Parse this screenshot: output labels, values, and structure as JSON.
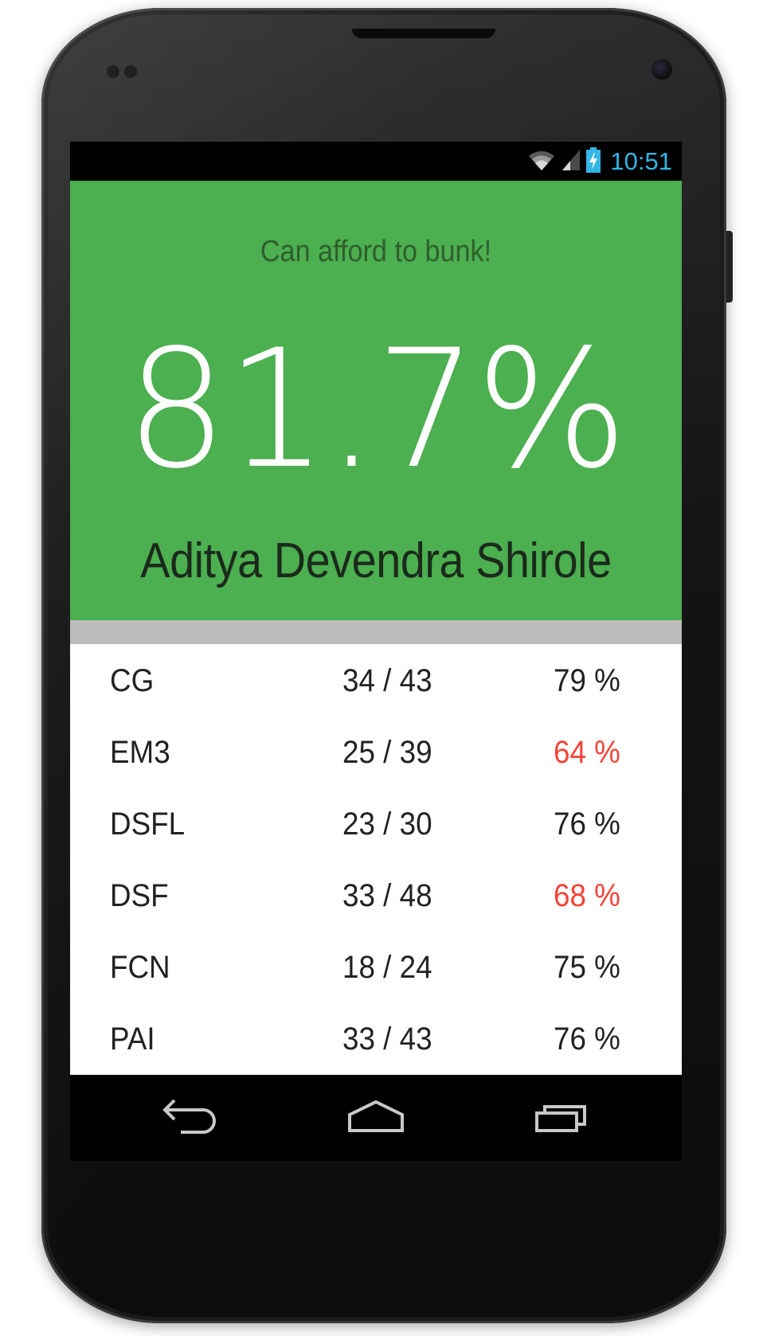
{
  "status_bar": {
    "time": "10:51",
    "icons": [
      "wifi-icon",
      "signal-icon",
      "battery-charging-icon"
    ]
  },
  "colors": {
    "header_bg": "#4caf50",
    "low_percent": "#f44336",
    "time_color": "#33b5e5"
  },
  "header": {
    "message": "Can afford to bunk!",
    "overall_percent": "81.7%",
    "student_name": "Aditya Devendra Shirole"
  },
  "subjects": [
    {
      "name": "CG",
      "attended": "34 / 43",
      "percent": "79 %",
      "low": false
    },
    {
      "name": "EM3",
      "attended": "25 / 39",
      "percent": "64 %",
      "low": true
    },
    {
      "name": "DSFL",
      "attended": "23 / 30",
      "percent": "76 %",
      "low": false
    },
    {
      "name": "DSF",
      "attended": "33 / 48",
      "percent": "68 %",
      "low": true
    },
    {
      "name": "FCN",
      "attended": "18 / 24",
      "percent": "75 %",
      "low": false
    },
    {
      "name": "PAI",
      "attended": "33 / 43",
      "percent": "76 %",
      "low": false
    }
  ],
  "nav_bar": {
    "icons": [
      "back-icon",
      "home-icon",
      "recent-apps-icon"
    ]
  }
}
